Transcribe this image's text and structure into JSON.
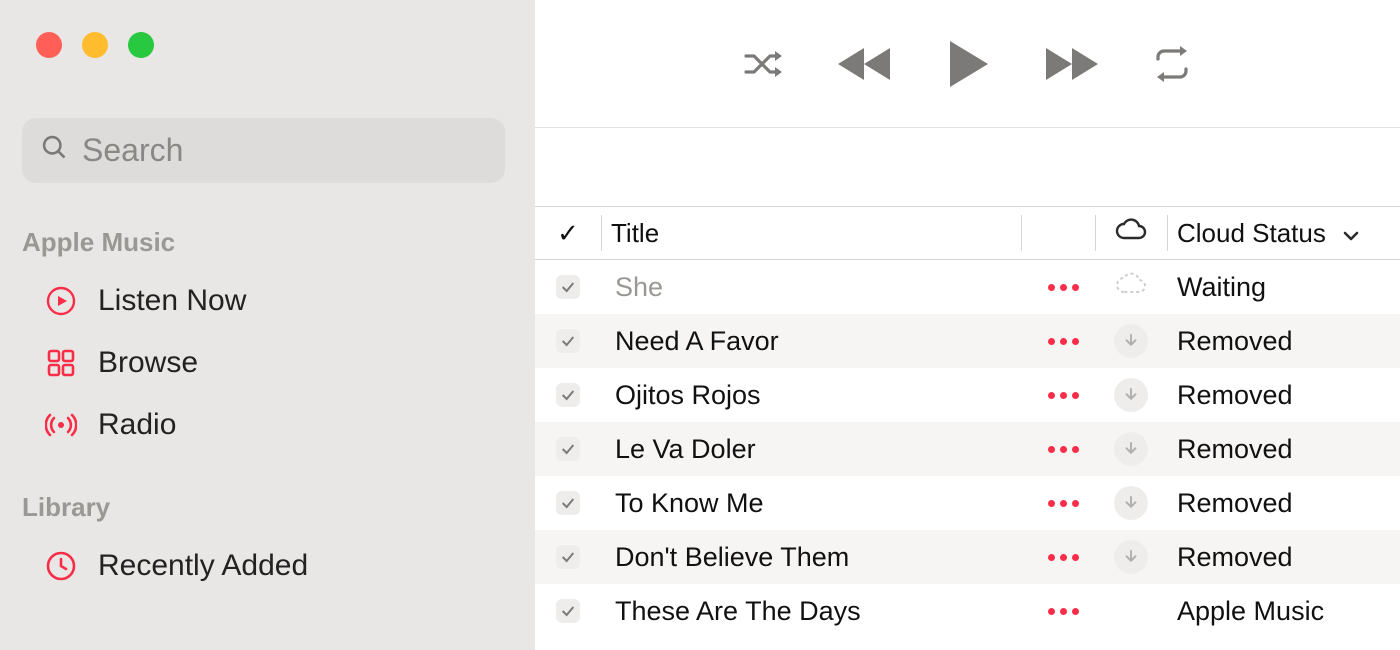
{
  "search": {
    "placeholder": "Search"
  },
  "sidebar": {
    "sections": [
      {
        "label": "Apple Music",
        "items": [
          {
            "icon": "play-circle-icon",
            "label": "Listen Now"
          },
          {
            "icon": "grid-icon",
            "label": "Browse"
          },
          {
            "icon": "radio-icon",
            "label": "Radio"
          }
        ]
      },
      {
        "label": "Library",
        "items": [
          {
            "icon": "clock-icon",
            "label": "Recently Added"
          }
        ]
      }
    ]
  },
  "columns": {
    "check": "✓",
    "title": "Title",
    "cloud_header": "Cloud Status"
  },
  "tracks": [
    {
      "checked": true,
      "title": "She",
      "cloud_icon": "waiting",
      "status": "Waiting",
      "dim": true
    },
    {
      "checked": true,
      "title": "Need A Favor",
      "cloud_icon": "removed",
      "status": "Removed",
      "dim": false
    },
    {
      "checked": true,
      "title": "Ojitos Rojos",
      "cloud_icon": "removed",
      "status": "Removed",
      "dim": false
    },
    {
      "checked": true,
      "title": "Le Va Doler",
      "cloud_icon": "removed",
      "status": "Removed",
      "dim": false
    },
    {
      "checked": true,
      "title": "To Know Me",
      "cloud_icon": "removed",
      "status": "Removed",
      "dim": false
    },
    {
      "checked": true,
      "title": "Don't Believe Them",
      "cloud_icon": "removed",
      "status": "Removed",
      "dim": false
    },
    {
      "checked": true,
      "title": "These Are The Days",
      "cloud_icon": "none",
      "status": "Apple Music",
      "dim": false
    }
  ]
}
